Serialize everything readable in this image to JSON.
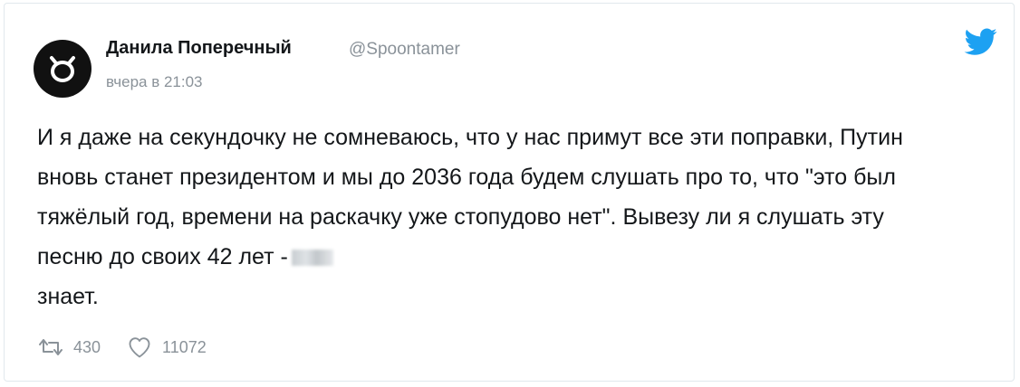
{
  "tweet": {
    "author_name": "Данила Поперечный",
    "handle": "@Spoontamer",
    "timestamp": "вчера в 21:03",
    "text_main": "И я даже на секундочку не сомневаюсь, что у нас примут все эти поправки, Путин вновь станет президентом и мы до 2036 года будем слушать про то, что \"это был тяжёлый год, времени на раскачку уже стопудово нет\". Вывезу ли я слушать эту песню до своих 42 лет -",
    "text_end": "знает.",
    "retweets": "430",
    "likes": "11072"
  },
  "icons": {
    "avatar": "avatar-logo-icon",
    "platform": "twitter-bird-icon",
    "retweet": "retweet-icon",
    "like": "heart-icon",
    "censored": "blurred-word"
  },
  "colors": {
    "twitter_blue": "#1da1f2",
    "text": "#14171a",
    "muted": "#8a9299",
    "avatar_bg": "#111111"
  }
}
